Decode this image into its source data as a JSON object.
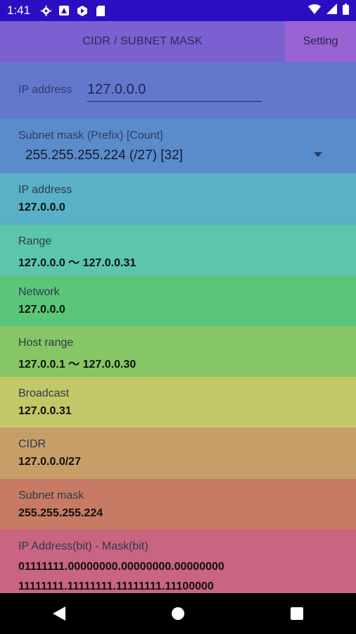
{
  "status_bar": {
    "time": "1:41",
    "left_icons": [
      "gear-icon",
      "contact-icon",
      "play-icon",
      "sd-card-icon"
    ],
    "right_icons": [
      "wifi-icon",
      "signal-icon",
      "battery-icon"
    ]
  },
  "app_bar": {
    "title": "CIDR / SUBNET MASK",
    "setting_label": "Setting"
  },
  "ip_input": {
    "label": "IP address",
    "value": "127.0.0.0"
  },
  "subnet_select": {
    "label": "Subnet mask (Prefix) [Count]",
    "value": "255.255.255.224 (/27) [32]"
  },
  "results": [
    {
      "label": "IP address",
      "value": "127.0.0.0",
      "color": "#5ab0c6"
    },
    {
      "label": "Range",
      "value": "127.0.0.0 〜 127.0.0.31",
      "color": "#5cc6ac"
    },
    {
      "label": "Network",
      "value": "127.0.0.0",
      "color": "#5ac67a"
    },
    {
      "label": "Host range",
      "value": "127.0.0.1 〜 127.0.0.30",
      "color": "#86c664"
    },
    {
      "label": "Broadcast",
      "value": "127.0.0.31",
      "color": "#c2c868"
    },
    {
      "label": "CIDR",
      "value": "127.0.0.0/27",
      "color": "#c89e68"
    },
    {
      "label": "Subnet mask",
      "value": "255.255.255.224",
      "color": "#c77a64"
    }
  ],
  "bits": {
    "label": "IP Address(bit) - Mask(bit)",
    "ip_bits": "01111111.00000000.00000000.00000000",
    "mask_bits": "11111111.11111111.11111111.11100000",
    "color": "#c96482"
  },
  "nav_bar": {
    "back_icon": "back-triangle-icon",
    "home_icon": "home-circle-icon",
    "recents_icon": "recents-square-icon"
  }
}
